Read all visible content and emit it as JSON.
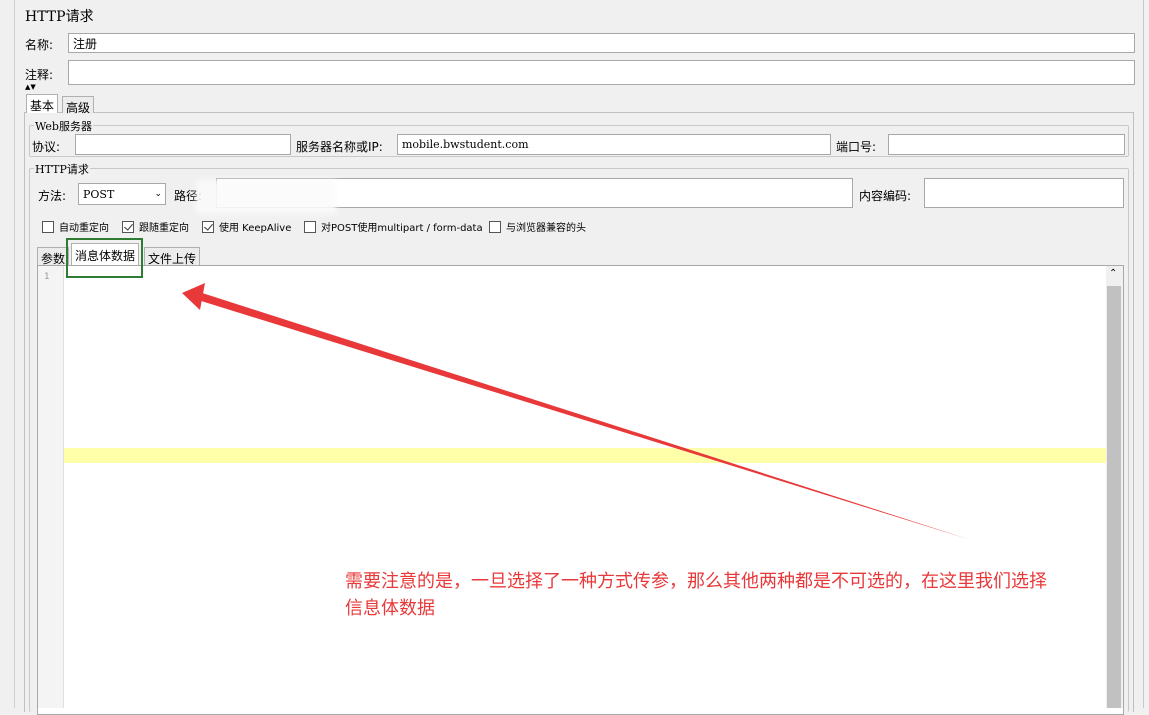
{
  "panel_title": "HTTP请求",
  "name": {
    "label": "名称:",
    "value": "注册"
  },
  "comment": {
    "label": "注释:",
    "value": ""
  },
  "outer_tabs": [
    {
      "label": "基本"
    },
    {
      "label": "高级"
    }
  ],
  "web_server": {
    "title": "Web服务器",
    "protocol_label": "协议:",
    "protocol_value": "",
    "server_label": "服务器名称或IP:",
    "server_value": "mobile.bwstudent.com",
    "port_label": "端口号:",
    "port_value": ""
  },
  "http_request": {
    "title": "HTTP请求",
    "method_label": "方法:",
    "method_value": "POST",
    "path_label": "路径:",
    "path_value": "",
    "encoding_label": "内容编码:",
    "encoding_value": ""
  },
  "checkboxes": [
    {
      "label": "自动重定向",
      "checked": false
    },
    {
      "label": "跟随重定向",
      "checked": true
    },
    {
      "label": "使用 KeepAlive",
      "checked": true
    },
    {
      "label": "对POST使用multipart / form-data",
      "checked": false
    },
    {
      "label": "与浏览器兼容的头",
      "checked": false
    }
  ],
  "inner_tabs": [
    {
      "label": "参数"
    },
    {
      "label": "消息体数据"
    },
    {
      "label": "文件上传"
    }
  ],
  "editor": {
    "line_number": "1"
  },
  "annotation": {
    "text_line1": "需要注意的是，一旦选择了一种方式传参，那么其他两种都是不可选的，在这里我们选择",
    "text_line2": "信息体数据",
    "color": "#e8383a",
    "highlight_box_color": "#2e7d32"
  }
}
